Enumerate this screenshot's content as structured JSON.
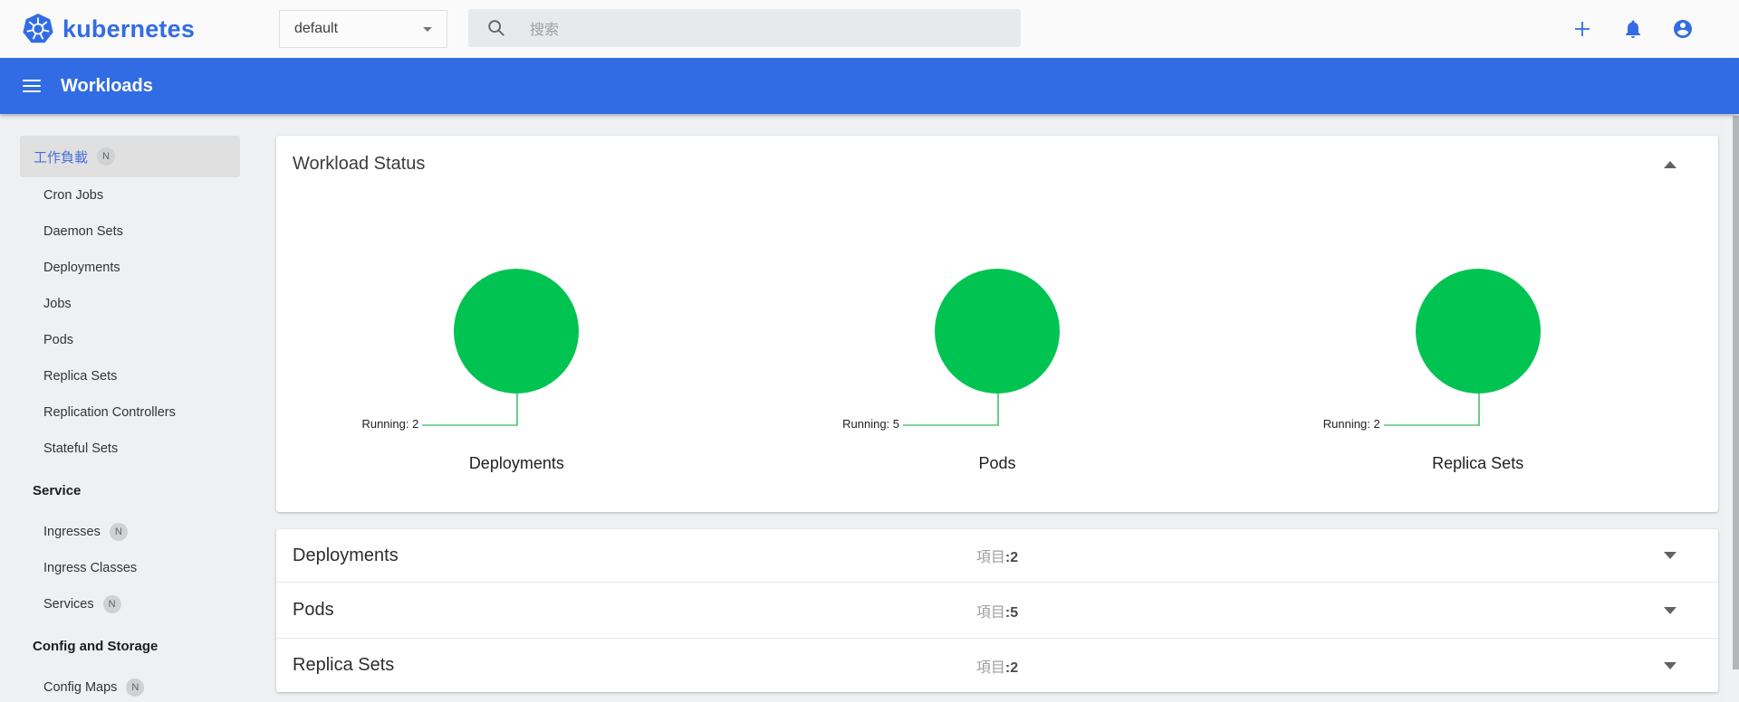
{
  "header": {
    "brand": "kubernetes",
    "namespace_select": {
      "value": "default"
    },
    "search": {
      "placeholder": "搜索"
    }
  },
  "appbar": {
    "title": "Workloads"
  },
  "sidebar": {
    "items": [
      {
        "label": "工作負載",
        "type": "selected",
        "badge": "N"
      },
      {
        "label": "Cron Jobs",
        "type": "item"
      },
      {
        "label": "Daemon Sets",
        "type": "item"
      },
      {
        "label": "Deployments",
        "type": "item"
      },
      {
        "label": "Jobs",
        "type": "item"
      },
      {
        "label": "Pods",
        "type": "item"
      },
      {
        "label": "Replica Sets",
        "type": "item"
      },
      {
        "label": "Replication Controllers",
        "type": "item"
      },
      {
        "label": "Stateful Sets",
        "type": "item"
      },
      {
        "label": "Service",
        "type": "header"
      },
      {
        "label": "Ingresses",
        "type": "item",
        "badge": "N"
      },
      {
        "label": "Ingress Classes",
        "type": "item"
      },
      {
        "label": "Services",
        "type": "item",
        "badge": "N"
      },
      {
        "label": "Config and Storage",
        "type": "header"
      },
      {
        "label": "Config Maps",
        "type": "item",
        "badge": "N"
      }
    ]
  },
  "workload_status": {
    "title": "Workload Status",
    "charts": [
      {
        "title": "Deployments",
        "annotation": "Running: 2"
      },
      {
        "title": "Pods",
        "annotation": "Running: 5"
      },
      {
        "title": "Replica Sets",
        "annotation": "Running: 2"
      }
    ]
  },
  "panels": [
    {
      "title": "Deployments",
      "items_label": "項目",
      "separator": ":",
      "count": "2"
    },
    {
      "title": "Pods",
      "items_label": "項目",
      "separator": ":",
      "count": "5"
    },
    {
      "title": "Replica Sets",
      "items_label": "項目",
      "separator": ":",
      "count": "2"
    }
  ],
  "chart_data": [
    {
      "type": "pie",
      "title": "Deployments",
      "slices": [
        {
          "label": "Running",
          "value": 2,
          "color": "#00c352"
        }
      ],
      "legend_position": "bottom-left"
    },
    {
      "type": "pie",
      "title": "Pods",
      "slices": [
        {
          "label": "Running",
          "value": 5,
          "color": "#00c352"
        }
      ],
      "legend_position": "bottom-left"
    },
    {
      "type": "pie",
      "title": "Replica Sets",
      "slices": [
        {
          "label": "Running",
          "value": 2,
          "color": "#00c352"
        }
      ],
      "legend_position": "bottom-left"
    }
  ],
  "colors": {
    "primary": "#326ce5",
    "success": "#00c352"
  }
}
